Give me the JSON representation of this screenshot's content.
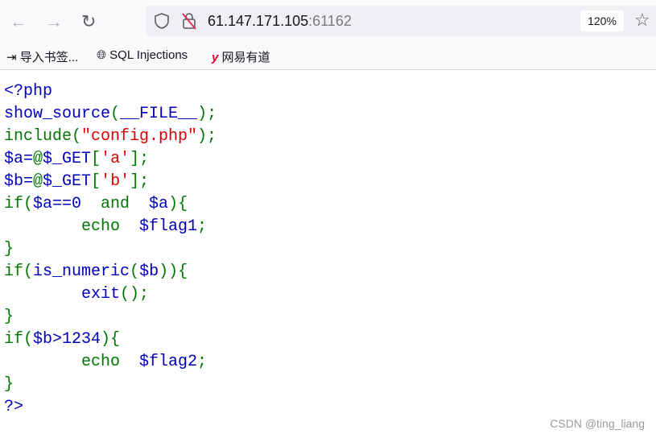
{
  "browser": {
    "url_host": "61.147.171.105",
    "url_port": ":61162",
    "zoom": "120%"
  },
  "bookmarks": [
    {
      "label": "导入书签...",
      "icon": "import-icon"
    },
    {
      "label": "SQL Injections",
      "icon": "globe-icon"
    },
    {
      "label": "网易有道",
      "icon": "youdao-icon"
    }
  ],
  "code": [
    [
      [
        "<?php",
        "d"
      ]
    ],
    [
      [
        "show_source",
        "d"
      ],
      [
        "(",
        "k"
      ],
      [
        "__FILE__",
        "d"
      ],
      [
        ");",
        "k"
      ]
    ],
    [
      [
        "include(",
        "k"
      ],
      [
        "\"config.php\"",
        "s"
      ],
      [
        ");",
        "k"
      ]
    ],
    [
      [
        "$a=",
        "d"
      ],
      [
        "@",
        "k"
      ],
      [
        "$_GET",
        "d"
      ],
      [
        "[",
        "k"
      ],
      [
        "'a'",
        "s"
      ],
      [
        "];",
        "k"
      ]
    ],
    [
      [
        "$b=",
        "d"
      ],
      [
        "@",
        "k"
      ],
      [
        "$_GET",
        "d"
      ],
      [
        "[",
        "k"
      ],
      [
        "'b'",
        "s"
      ],
      [
        "];",
        "k"
      ]
    ],
    [
      [
        "if(",
        "k"
      ],
      [
        "$a==0",
        "d"
      ],
      [
        "  and  ",
        "k"
      ],
      [
        "$a",
        "d"
      ],
      [
        "){",
        "k"
      ]
    ],
    [
      [
        "        echo  ",
        "k"
      ],
      [
        "$flag1",
        "d"
      ],
      [
        ";",
        "k"
      ]
    ],
    [
      [
        "}",
        "k"
      ]
    ],
    [
      [
        "if(",
        "k"
      ],
      [
        "is_numeric",
        "d"
      ],
      [
        "(",
        "k"
      ],
      [
        "$b",
        "d"
      ],
      [
        ")){",
        "k"
      ]
    ],
    [
      [
        "        ",
        "k"
      ],
      [
        "exit",
        "d"
      ],
      [
        "();",
        "k"
      ]
    ],
    [
      [
        "}",
        "k"
      ]
    ],
    [
      [
        "if(",
        "k"
      ],
      [
        "$b>1234",
        "d"
      ],
      [
        "){",
        "k"
      ]
    ],
    [
      [
        "        echo  ",
        "k"
      ],
      [
        "$flag2",
        "d"
      ],
      [
        ";",
        "k"
      ]
    ],
    [
      [
        "}",
        "k"
      ]
    ],
    [
      [
        "?>",
        "d"
      ]
    ]
  ],
  "watermark": "CSDN @ting_liang"
}
